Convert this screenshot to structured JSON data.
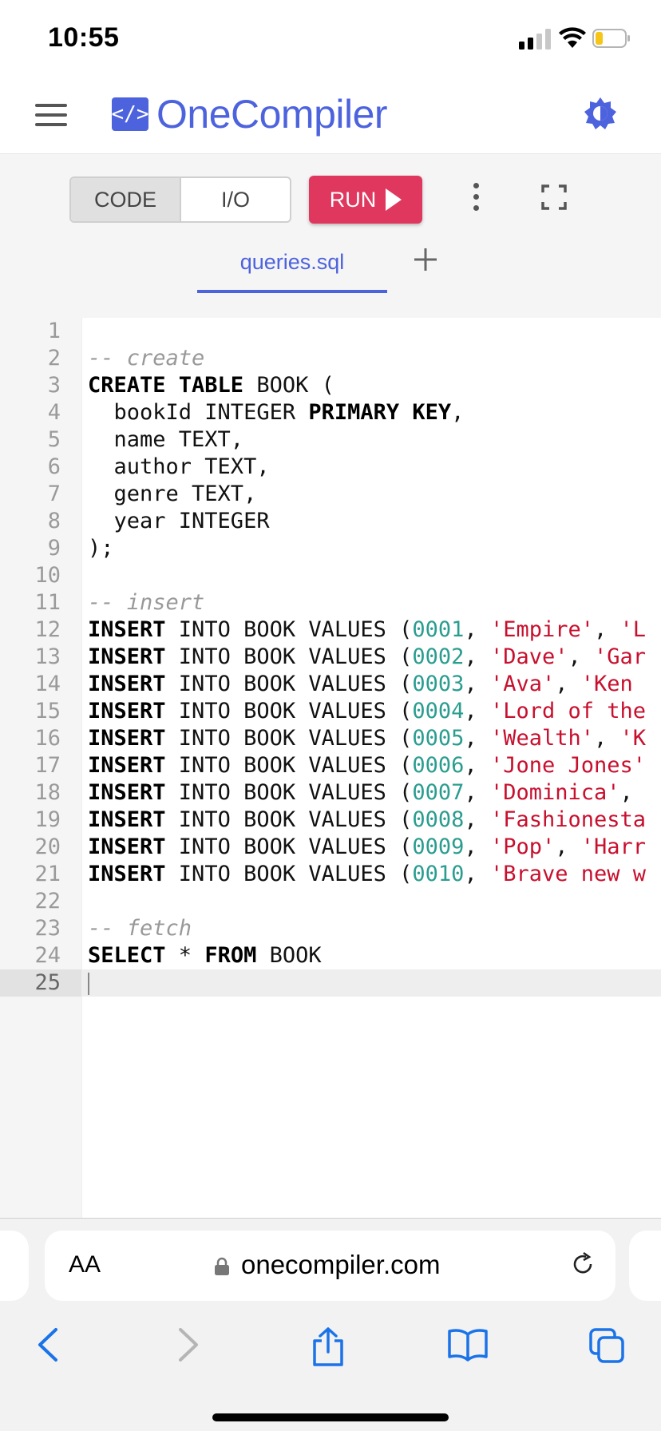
{
  "status_bar": {
    "time": "10:55"
  },
  "header": {
    "logo_badge": "</>",
    "logo_text": "OneCompiler"
  },
  "toolbar": {
    "code_label": "CODE",
    "io_label": "I/O",
    "run_label": "RUN"
  },
  "tabs": [
    {
      "label": "queries.sql"
    }
  ],
  "editor": {
    "line_numbers": [
      "1",
      "2",
      "3",
      "4",
      "5",
      "6",
      "7",
      "8",
      "9",
      "10",
      "11",
      "12",
      "13",
      "14",
      "15",
      "16",
      "17",
      "18",
      "19",
      "20",
      "21",
      "22",
      "23",
      "24",
      "25"
    ],
    "current_line": 25,
    "lines": [
      [],
      [
        {
          "t": "-- create",
          "c": "cm"
        }
      ],
      [
        {
          "t": "CREATE TABLE",
          "c": "kw"
        },
        {
          "t": " BOOK (",
          "c": ""
        }
      ],
      [
        {
          "t": "  bookId INTEGER ",
          "c": ""
        },
        {
          "t": "PRIMARY KEY",
          "c": "kw"
        },
        {
          "t": ",",
          "c": ""
        }
      ],
      [
        {
          "t": "  name TEXT,",
          "c": ""
        }
      ],
      [
        {
          "t": "  author TEXT,",
          "c": ""
        }
      ],
      [
        {
          "t": "  genre TEXT,",
          "c": ""
        }
      ],
      [
        {
          "t": "  year INTEGER",
          "c": ""
        }
      ],
      [
        {
          "t": ");",
          "c": ""
        }
      ],
      [],
      [
        {
          "t": "-- insert",
          "c": "cm"
        }
      ],
      [
        {
          "t": "INSERT",
          "c": "kw"
        },
        {
          "t": " INTO BOOK VALUES (",
          "c": ""
        },
        {
          "t": "0001",
          "c": "num"
        },
        {
          "t": ", ",
          "c": ""
        },
        {
          "t": "'Empire'",
          "c": "str"
        },
        {
          "t": ", ",
          "c": ""
        },
        {
          "t": "'L",
          "c": "str"
        }
      ],
      [
        {
          "t": "INSERT",
          "c": "kw"
        },
        {
          "t": " INTO BOOK VALUES (",
          "c": ""
        },
        {
          "t": "0002",
          "c": "num"
        },
        {
          "t": ", ",
          "c": ""
        },
        {
          "t": "'Dave'",
          "c": "str"
        },
        {
          "t": ", ",
          "c": ""
        },
        {
          "t": "'Gar",
          "c": "str"
        }
      ],
      [
        {
          "t": "INSERT",
          "c": "kw"
        },
        {
          "t": " INTO BOOK VALUES (",
          "c": ""
        },
        {
          "t": "0003",
          "c": "num"
        },
        {
          "t": ", ",
          "c": ""
        },
        {
          "t": "'Ava'",
          "c": "str"
        },
        {
          "t": ", ",
          "c": ""
        },
        {
          "t": "'Ken",
          "c": "str"
        }
      ],
      [
        {
          "t": "INSERT",
          "c": "kw"
        },
        {
          "t": " INTO BOOK VALUES (",
          "c": ""
        },
        {
          "t": "0004",
          "c": "num"
        },
        {
          "t": ", ",
          "c": ""
        },
        {
          "t": "'Lord of the",
          "c": "str"
        }
      ],
      [
        {
          "t": "INSERT",
          "c": "kw"
        },
        {
          "t": " INTO BOOK VALUES (",
          "c": ""
        },
        {
          "t": "0005",
          "c": "num"
        },
        {
          "t": ", ",
          "c": ""
        },
        {
          "t": "'Wealth'",
          "c": "str"
        },
        {
          "t": ", ",
          "c": ""
        },
        {
          "t": "'K",
          "c": "str"
        }
      ],
      [
        {
          "t": "INSERT",
          "c": "kw"
        },
        {
          "t": " INTO BOOK VALUES (",
          "c": ""
        },
        {
          "t": "0006",
          "c": "num"
        },
        {
          "t": ", ",
          "c": ""
        },
        {
          "t": "'Jone Jones'",
          "c": "str"
        }
      ],
      [
        {
          "t": "INSERT",
          "c": "kw"
        },
        {
          "t": " INTO BOOK VALUES (",
          "c": ""
        },
        {
          "t": "0007",
          "c": "num"
        },
        {
          "t": ", ",
          "c": ""
        },
        {
          "t": "'Dominica'",
          "c": "str"
        },
        {
          "t": ",",
          "c": ""
        }
      ],
      [
        {
          "t": "INSERT",
          "c": "kw"
        },
        {
          "t": " INTO BOOK VALUES (",
          "c": ""
        },
        {
          "t": "0008",
          "c": "num"
        },
        {
          "t": ", ",
          "c": ""
        },
        {
          "t": "'Fashionesta",
          "c": "str"
        }
      ],
      [
        {
          "t": "INSERT",
          "c": "kw"
        },
        {
          "t": " INTO BOOK VALUES (",
          "c": ""
        },
        {
          "t": "0009",
          "c": "num"
        },
        {
          "t": ", ",
          "c": ""
        },
        {
          "t": "'Pop'",
          "c": "str"
        },
        {
          "t": ", ",
          "c": ""
        },
        {
          "t": "'Harr",
          "c": "str"
        }
      ],
      [
        {
          "t": "INSERT",
          "c": "kw"
        },
        {
          "t": " INTO BOOK VALUES (",
          "c": ""
        },
        {
          "t": "0010",
          "c": "num"
        },
        {
          "t": ", ",
          "c": ""
        },
        {
          "t": "'Brave new w",
          "c": "str"
        }
      ],
      [],
      [
        {
          "t": "-- fetch",
          "c": "cm"
        }
      ],
      [
        {
          "t": "SELECT",
          "c": "kw"
        },
        {
          "t": " * ",
          "c": ""
        },
        {
          "t": "FROM",
          "c": "kw"
        },
        {
          "t": " BOOK",
          "c": ""
        }
      ],
      []
    ]
  },
  "safari": {
    "aa_label": "AA",
    "url": "onecompiler.com"
  },
  "colors": {
    "brand": "#4d63de",
    "run": "#e0375e",
    "keyword": "#000000",
    "number": "#2a9d8f",
    "string": "#c8102e",
    "comment": "#999999",
    "ios_blue": "#1a73e8"
  },
  "icons": [
    "menu-icon",
    "theme-toggle-icon",
    "more-vertical-icon",
    "fullscreen-icon",
    "plus-icon",
    "lock-icon",
    "reload-icon",
    "back-icon",
    "forward-icon",
    "share-icon",
    "bookmarks-icon",
    "tabs-icon"
  ]
}
